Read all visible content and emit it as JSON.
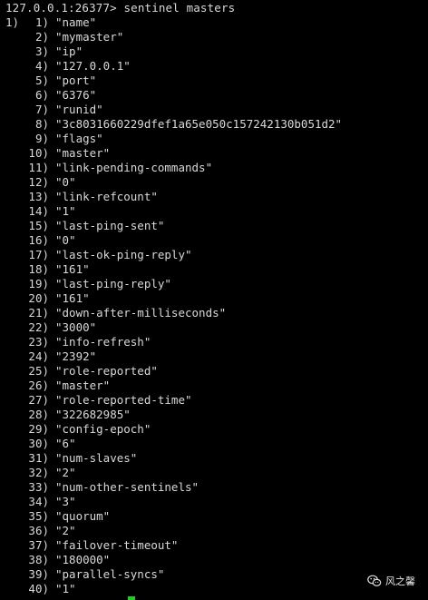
{
  "terminal": {
    "prompt": "127.0.0.1:26377> sentinel masters",
    "outer_index": "1)",
    "rows": [
      {
        "n": "1)",
        "v": "\"name\""
      },
      {
        "n": "2)",
        "v": "\"mymaster\""
      },
      {
        "n": "3)",
        "v": "\"ip\""
      },
      {
        "n": "4)",
        "v": "\"127.0.0.1\""
      },
      {
        "n": "5)",
        "v": "\"port\""
      },
      {
        "n": "6)",
        "v": "\"6376\""
      },
      {
        "n": "7)",
        "v": "\"runid\""
      },
      {
        "n": "8)",
        "v": "\"3c8031660229dfef1a65e050c157242130b051d2\""
      },
      {
        "n": "9)",
        "v": "\"flags\""
      },
      {
        "n": "10)",
        "v": "\"master\""
      },
      {
        "n": "11)",
        "v": "\"link-pending-commands\""
      },
      {
        "n": "12)",
        "v": "\"0\""
      },
      {
        "n": "13)",
        "v": "\"link-refcount\""
      },
      {
        "n": "14)",
        "v": "\"1\""
      },
      {
        "n": "15)",
        "v": "\"last-ping-sent\""
      },
      {
        "n": "16)",
        "v": "\"0\""
      },
      {
        "n": "17)",
        "v": "\"last-ok-ping-reply\""
      },
      {
        "n": "18)",
        "v": "\"161\""
      },
      {
        "n": "19)",
        "v": "\"last-ping-reply\""
      },
      {
        "n": "20)",
        "v": "\"161\""
      },
      {
        "n": "21)",
        "v": "\"down-after-milliseconds\""
      },
      {
        "n": "22)",
        "v": "\"3000\""
      },
      {
        "n": "23)",
        "v": "\"info-refresh\""
      },
      {
        "n": "24)",
        "v": "\"2392\""
      },
      {
        "n": "25)",
        "v": "\"role-reported\""
      },
      {
        "n": "26)",
        "v": "\"master\""
      },
      {
        "n": "27)",
        "v": "\"role-reported-time\""
      },
      {
        "n": "28)",
        "v": "\"322682985\""
      },
      {
        "n": "29)",
        "v": "\"config-epoch\""
      },
      {
        "n": "30)",
        "v": "\"6\""
      },
      {
        "n": "31)",
        "v": "\"num-slaves\""
      },
      {
        "n": "32)",
        "v": "\"2\""
      },
      {
        "n": "33)",
        "v": "\"num-other-sentinels\""
      },
      {
        "n": "34)",
        "v": "\"3\""
      },
      {
        "n": "35)",
        "v": "\"quorum\""
      },
      {
        "n": "36)",
        "v": "\"2\""
      },
      {
        "n": "37)",
        "v": "\"failover-timeout\""
      },
      {
        "n": "38)",
        "v": "\"180000\""
      },
      {
        "n": "39)",
        "v": "\"parallel-syncs\""
      },
      {
        "n": "40)",
        "v": "\"1\""
      }
    ]
  },
  "watermark": {
    "text": "风之馨",
    "icon": "wechat-icon"
  },
  "colors": {
    "background": "#000000",
    "text": "#d9d9d9",
    "cursor": "#22cc22"
  }
}
